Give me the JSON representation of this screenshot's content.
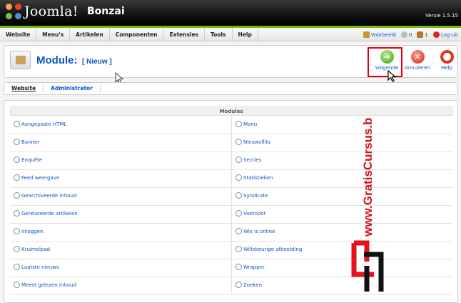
{
  "header": {
    "logo_text": "Joomla!",
    "site_name": "Bonzai",
    "version": "Versie 1.5.15"
  },
  "menu": {
    "items": [
      "Website",
      "Menu's",
      "Artikelen",
      "Componenten",
      "Extensies",
      "Tools",
      "Help"
    ]
  },
  "status": {
    "preview": "Voorbeeld",
    "messages": "0",
    "users": "1",
    "logout": "Log-uit"
  },
  "toolbar": {
    "title": "Module:",
    "subtitle": "[ Nieuw ]",
    "next_label": "Volgende",
    "cancel_label": "Annuleren",
    "help_label": "Help"
  },
  "tabs": [
    "Website",
    "Administrator"
  ],
  "modules": {
    "header": "Modules",
    "left": [
      "Aangepaste HTML",
      "Banner",
      "Enquête",
      "Feed weergave",
      "Gearchiveerde inhoud",
      "Gerelateerde artikelen",
      "Inloggen",
      "Kruimelpad",
      "Laatste nieuws",
      "Meest gelezen inhoud"
    ],
    "right": [
      "Menu",
      "Nieuwsflits",
      "Secties",
      "Statistieken",
      "Syndicate",
      "Voetnoot",
      "Wie is online",
      "Willekeurige afbeelding",
      "Wrapper",
      "Zoeken"
    ]
  },
  "watermark": "www.GratisCursus.be",
  "colors": {
    "link": "#0b55c4",
    "header_bg": "#000000",
    "accent_green": "#7ab51d",
    "highlight": "#e3000f"
  }
}
